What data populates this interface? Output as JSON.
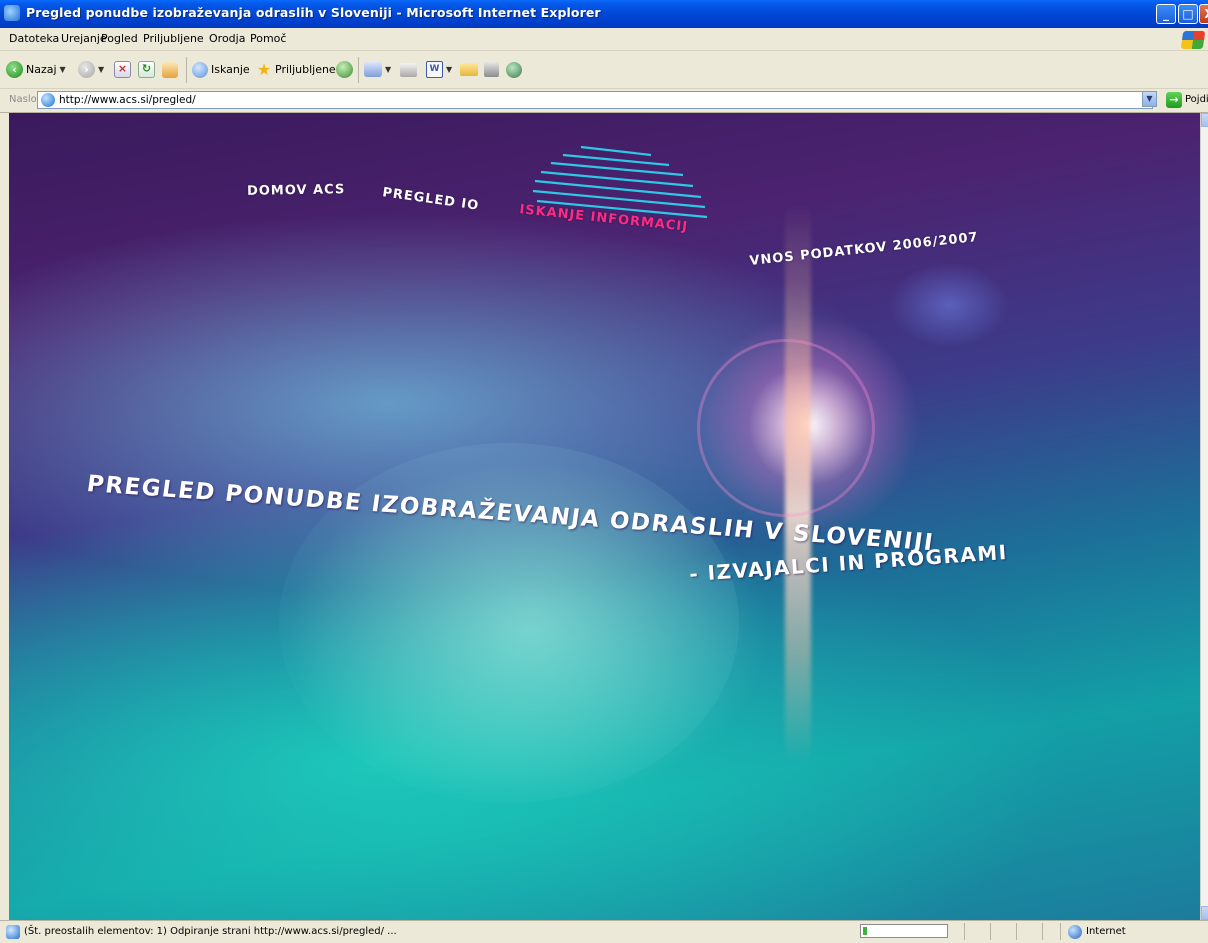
{
  "window": {
    "title": "Pregled ponudbe izobraževanja odraslih v Sloveniji - Microsoft Internet Explorer",
    "buttons": {
      "minimize": "_",
      "maximize": "□",
      "close": "X"
    }
  },
  "menu": [
    "Datoteka",
    "Urejanje",
    "Pogled",
    "Priljubljene",
    "Orodja",
    "Pomoč"
  ],
  "toolbar": {
    "back_label": "Nazaj",
    "search_label": "Iskanje",
    "favorites_label": "Priljubljene"
  },
  "address": {
    "label": "Naslov",
    "url": "http://www.acs.si/pregled/",
    "go_label": "Pojdi"
  },
  "page": {
    "nav": [
      {
        "label": "DOMOV ACS",
        "color": "#ffffff"
      },
      {
        "label": "PREGLED IO",
        "color": "#ffffff"
      },
      {
        "label": "ISKANJE INFORMACIJ",
        "color": "#ff2a86"
      },
      {
        "label": "VNOS PODATKOV 2006/2007",
        "color": "#ffffff"
      }
    ],
    "headline_line1": "PREGLED PONUDBE IZOBRAŽEVANJA ODRASLIH V SLOVENIJI",
    "headline_line2": "- IZVAJALCI IN PROGRAMI"
  },
  "status": {
    "text": "(Št. preostalih elementov: 1) Odpiranje strani http://www.acs.si/pregled/ ...",
    "progress": 0.05,
    "zone": "Internet"
  },
  "colors": {
    "titlebar": "#0046d5",
    "accent_pink": "#ff2a86",
    "accent_cyan": "#2ec8e6"
  }
}
